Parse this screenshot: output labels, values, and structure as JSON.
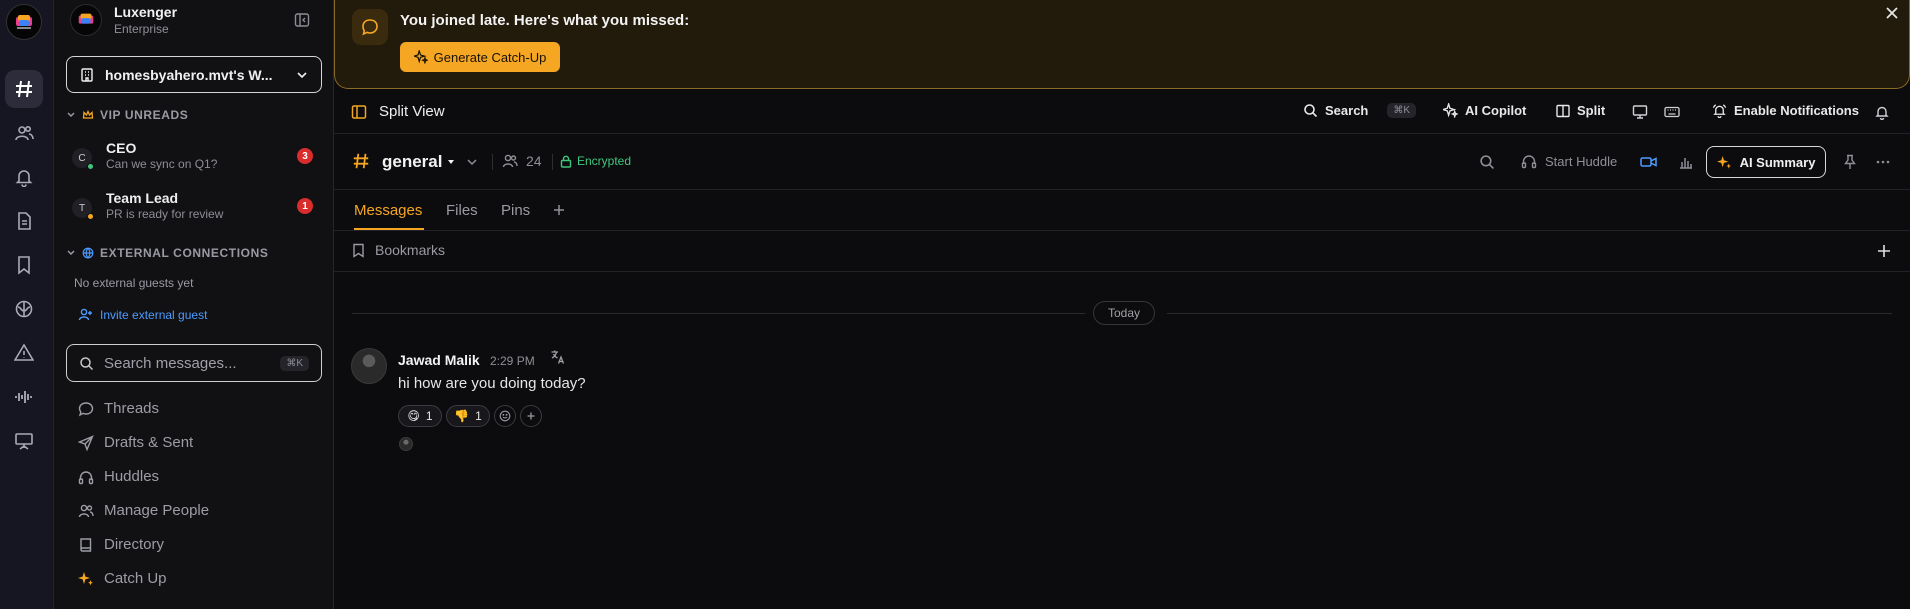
{
  "colors": {
    "accent": "#f5a623",
    "link": "#4d9bff",
    "encrypted": "#3fc77f",
    "badge": "#d92c2c",
    "online": "#3fc77f",
    "away": "#f5a623"
  },
  "workspace": {
    "name": "Luxenger",
    "plan": "Enterprise",
    "selector_label": "homesbyahero.mvt's W..."
  },
  "rail": {
    "icons": [
      "hash-icon",
      "users-icon",
      "bell-icon",
      "document-icon",
      "bookmark-icon",
      "brain-icon",
      "alert-icon",
      "waveform-icon",
      "presentation-icon"
    ]
  },
  "sidebar": {
    "vip_header": "VIP UNREADS",
    "dms": [
      {
        "initial": "C",
        "name": "CEO",
        "preview": "Can we sync on Q1?",
        "badge": "3",
        "status": "online"
      },
      {
        "initial": "T",
        "name": "Team Lead",
        "preview": "PR is ready for review",
        "badge": "1",
        "status": "away"
      }
    ],
    "external_header": "EXTERNAL CONNECTIONS",
    "external_empty": "No external guests yet",
    "invite_label": "Invite external guest",
    "search_placeholder": "Search messages...",
    "search_shortcut": "⌘K",
    "nav": [
      {
        "label": "Threads",
        "icon": "chat-bubble-icon"
      },
      {
        "label": "Drafts & Sent",
        "icon": "send-icon"
      },
      {
        "label": "Huddles",
        "icon": "headphones-icon"
      },
      {
        "label": "Manage People",
        "icon": "users-icon"
      },
      {
        "label": "Directory",
        "icon": "book-icon"
      },
      {
        "label": "Catch Up",
        "icon": "sparkles-icon"
      }
    ]
  },
  "banner": {
    "title": "You joined late. Here's what you missed:",
    "button_label": "Generate Catch-Up"
  },
  "toolbar": {
    "split_view": "Split View",
    "search": "Search",
    "search_shortcut": "⌘K",
    "ai_copilot": "AI Copilot",
    "split": "Split",
    "enable_notifications": "Enable Notifications"
  },
  "channel": {
    "name": "general",
    "members": "24",
    "encrypted": "Encrypted",
    "start_huddle": "Start Huddle",
    "ai_summary": "AI Summary"
  },
  "tabs": [
    "Messages",
    "Files",
    "Pins"
  ],
  "bookmarks_label": "Bookmarks",
  "day_divider": "Today",
  "message": {
    "author": "Jawad Malik",
    "time": "2:29 PM",
    "body": "hi how are you doing today?",
    "reactions": [
      {
        "emoji": "😋",
        "count": "1"
      },
      {
        "emoji": "👎",
        "count": "1"
      }
    ]
  }
}
